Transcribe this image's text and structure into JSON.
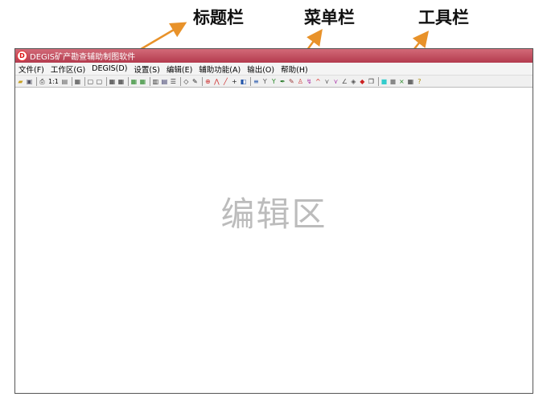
{
  "annotations": {
    "titlebar_label": "标题栏",
    "menubar_label": "菜单栏",
    "toolbar_label": "工具栏",
    "arrow_color": "#e8922a"
  },
  "window": {
    "title": "DEGIS矿产勘查辅助制图软件",
    "icon_letter": "D",
    "titlebar_color": "#c04a5c"
  },
  "menu": [
    "文件(F)",
    "工作区(G)",
    "DEGIS(D)",
    "设置(S)",
    "编辑(E)",
    "辅助功能(A)",
    "输出(O)",
    "帮助(H)"
  ],
  "toolbar": {
    "zoom_ratio": "1:1",
    "icons": [
      "open-folder-icon",
      "save-icon",
      "sep",
      "print-icon",
      "zoom-ratio-text",
      "paste-icon",
      "sep",
      "layer-icon",
      "sep",
      "frame-icon",
      "frame-alt-icon",
      "sep",
      "grid-icon",
      "grid-alt-icon",
      "sep",
      "table-green-icon",
      "table-green-alt-icon",
      "sep",
      "columns-icon",
      "chart-icon",
      "list-icon",
      "sep",
      "diamond-icon",
      "pen-icon",
      "sep",
      "target-icon",
      "polyline-icon",
      "line-icon",
      "cross-icon",
      "symbol-icon",
      "sep",
      "align-icon",
      "fork-icon",
      "fork-alt-icon",
      "brush-icon",
      "pencil-icon",
      "pin-icon",
      "hook-icon",
      "caret-icon",
      "branch-icon",
      "branch-alt-icon",
      "angle-icon",
      "shield-icon",
      "fill-icon",
      "copy-icon",
      "sep",
      "cyan-square-icon",
      "gray-square-icon",
      "multiply-icon",
      "grid-text-icon",
      "help-icon"
    ]
  },
  "editor": {
    "label": "编辑区"
  }
}
